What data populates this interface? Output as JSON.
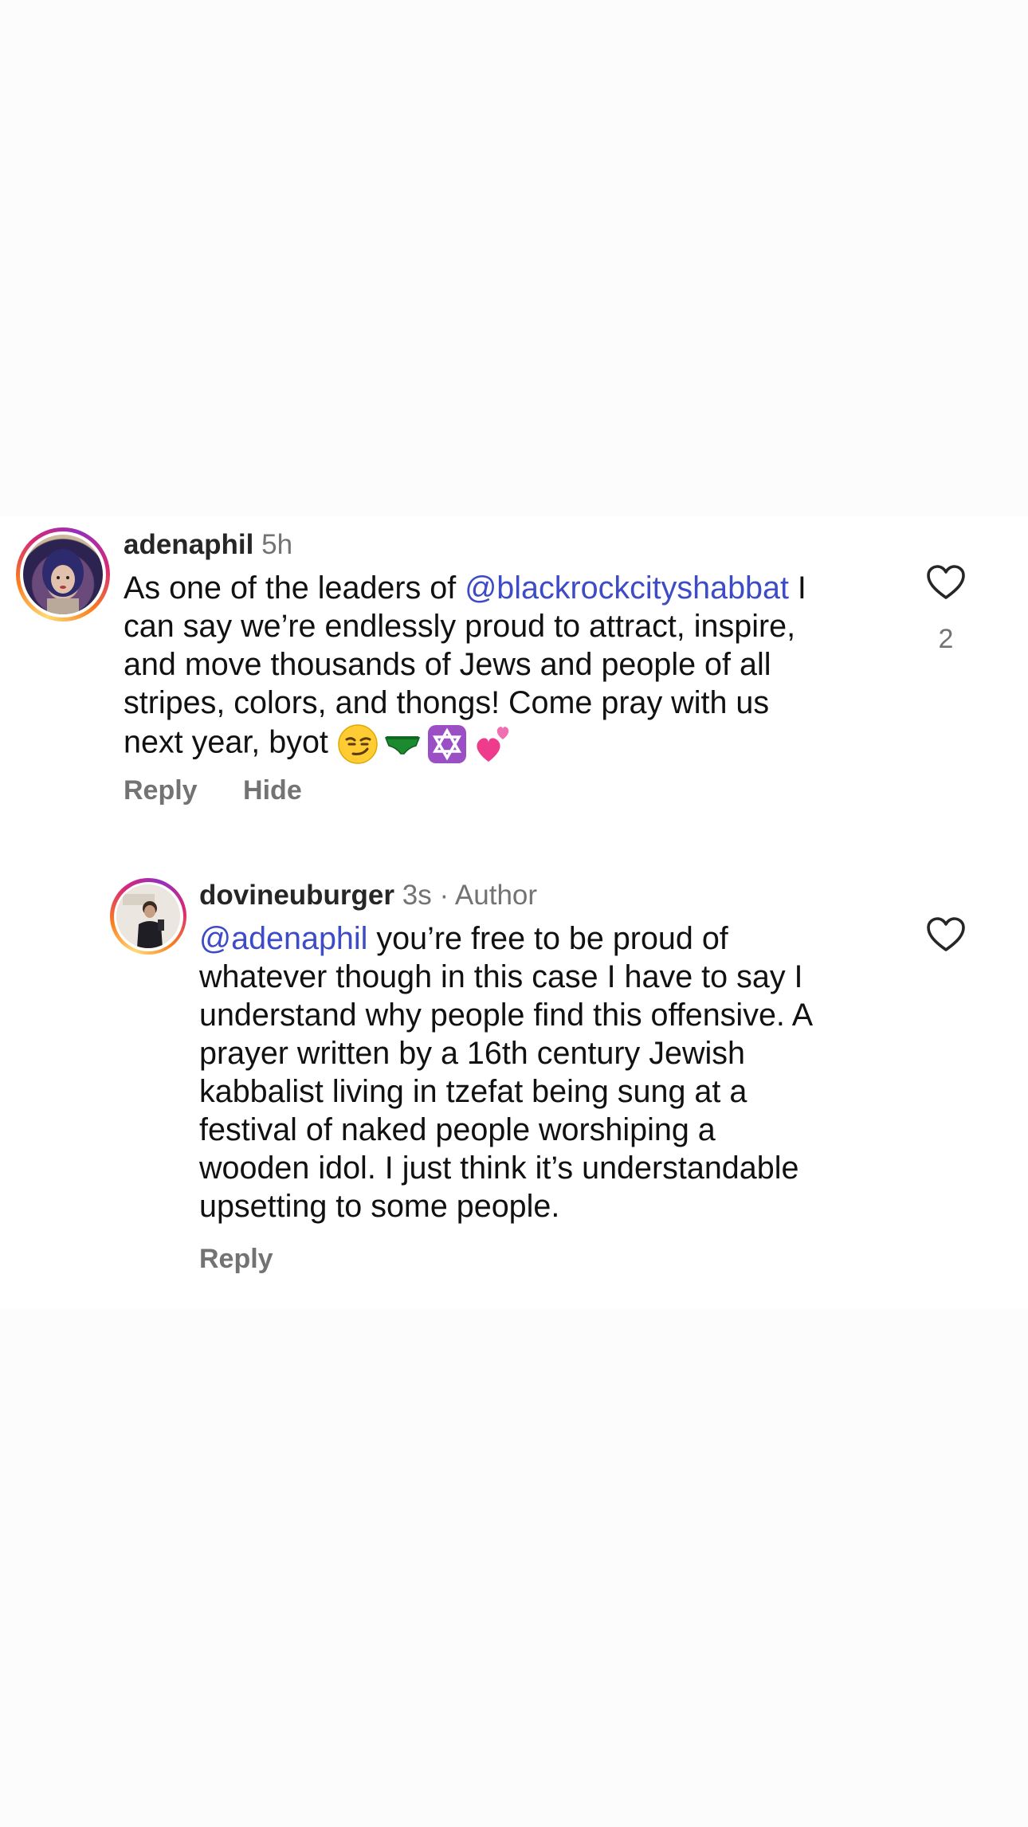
{
  "comments": [
    {
      "username": "adenaphil",
      "time": "5h",
      "text_lines": [
        {
          "mention": "",
          "text": "As one of the leaders of "
        },
        {
          "mention": "@blackrockcityshabbat",
          "text": " I"
        },
        {
          "mention": "",
          "text": "can say we’re endlessly proud to attract, inspire,"
        },
        {
          "mention": "",
          "text": "and move thousands of Jews and people of all"
        },
        {
          "mention": "",
          "text": "stripes, colors, and thongs!  Come pray with us"
        },
        {
          "mention": "",
          "text": "next year, byot"
        }
      ],
      "emojis": [
        "smirking-face",
        "green-underwear",
        "star-of-david",
        "two-hearts"
      ],
      "actions": [
        "Reply",
        "Hide"
      ],
      "like_count": "2"
    },
    {
      "username": "dovineuburger",
      "time": "3s",
      "badge": "· Author",
      "mention": "@adenaphil",
      "text_first": " you’re free to be proud of",
      "text_lines": [
        "whatever though in this case I have to say I",
        "understand why people find this offensive. A",
        "prayer written by a 16th century Jewish",
        "kabbalist living in tzefat being sung at a",
        "festival of naked people worshiping a",
        "wooden idol. I just think it’s understandable",
        "upsetting to some people."
      ],
      "actions": [
        "Reply"
      ]
    }
  ],
  "colors": {
    "mention": "#3d4bc6",
    "meta": "#737373",
    "username": "#262626",
    "background": "#fcfcfc"
  }
}
